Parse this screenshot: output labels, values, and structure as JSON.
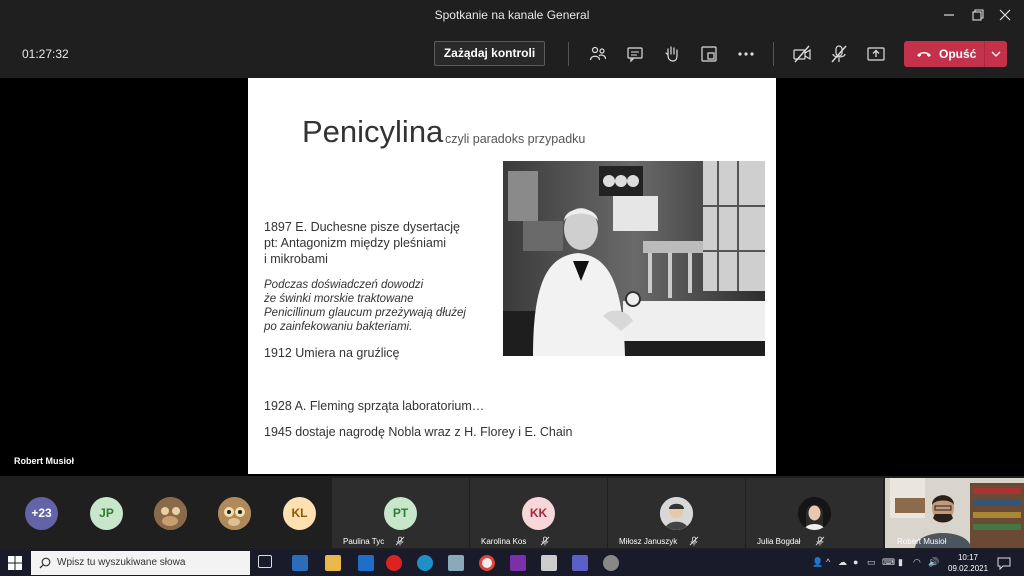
{
  "window": {
    "title": "Spotkanie na kanale General"
  },
  "toolbar": {
    "timer": "01:27:32",
    "request_control_label": "Zażądaj kontroli",
    "leave_label": "Opuść",
    "icons": [
      "participants-icon",
      "chat-icon",
      "raise-hand-icon",
      "rooms-icon",
      "more-icon",
      "camera-off-icon",
      "mic-off-icon",
      "share-icon"
    ],
    "leave_color": "#c4314b"
  },
  "stage": {
    "presenter_name": "Robert Musioł"
  },
  "slide": {
    "title": "Penicylina",
    "subtitle": "czyli paradoks przypadku",
    "line1": "1897 E. Duchesne pisze dysertację",
    "line2": "pt: Antagonizm między pleśniami",
    "line3": "i mikrobami",
    "italic1": "Podczas doświadczeń dowodzi",
    "italic2": "że świnki morskie traktowane",
    "italic3": "Penicillinum glaucum przeżywają dłużej",
    "italic4": "po zainfekowaniu bakteriami.",
    "line4": "1912 Umiera na gruźlicę",
    "line5": "1928 A. Fleming sprząta laboratorium…",
    "line6": "1945 dostaje nagrodę Nobla wraz z H. Florey i E. Chain"
  },
  "participants": {
    "overflow": "+23",
    "avatars": [
      {
        "initials": "JP",
        "color": "#c8e6c9",
        "text_color": "#2e7d32"
      },
      {
        "initials": "KL",
        "color": "#ffe0b2",
        "text_color": "#8d5a00"
      }
    ],
    "tiles": [
      {
        "initials": "PT",
        "name": "Paulina Tyc",
        "color": "#c8e6c9",
        "text_color": "#2e7d32"
      },
      {
        "initials": "KK",
        "name": "Karolina Kos",
        "color": "#f8d7da",
        "text_color": "#a12a3a"
      },
      {
        "initials": "",
        "name": "Miłosz Januszyk"
      },
      {
        "initials": "",
        "name": "Julia Bogdał"
      }
    ],
    "video_name": "Robert Musioł"
  },
  "taskbar": {
    "search_placeholder": "Wpisz tu wyszukiwane słowa",
    "time": "10:17",
    "date": "09.02.2021"
  }
}
